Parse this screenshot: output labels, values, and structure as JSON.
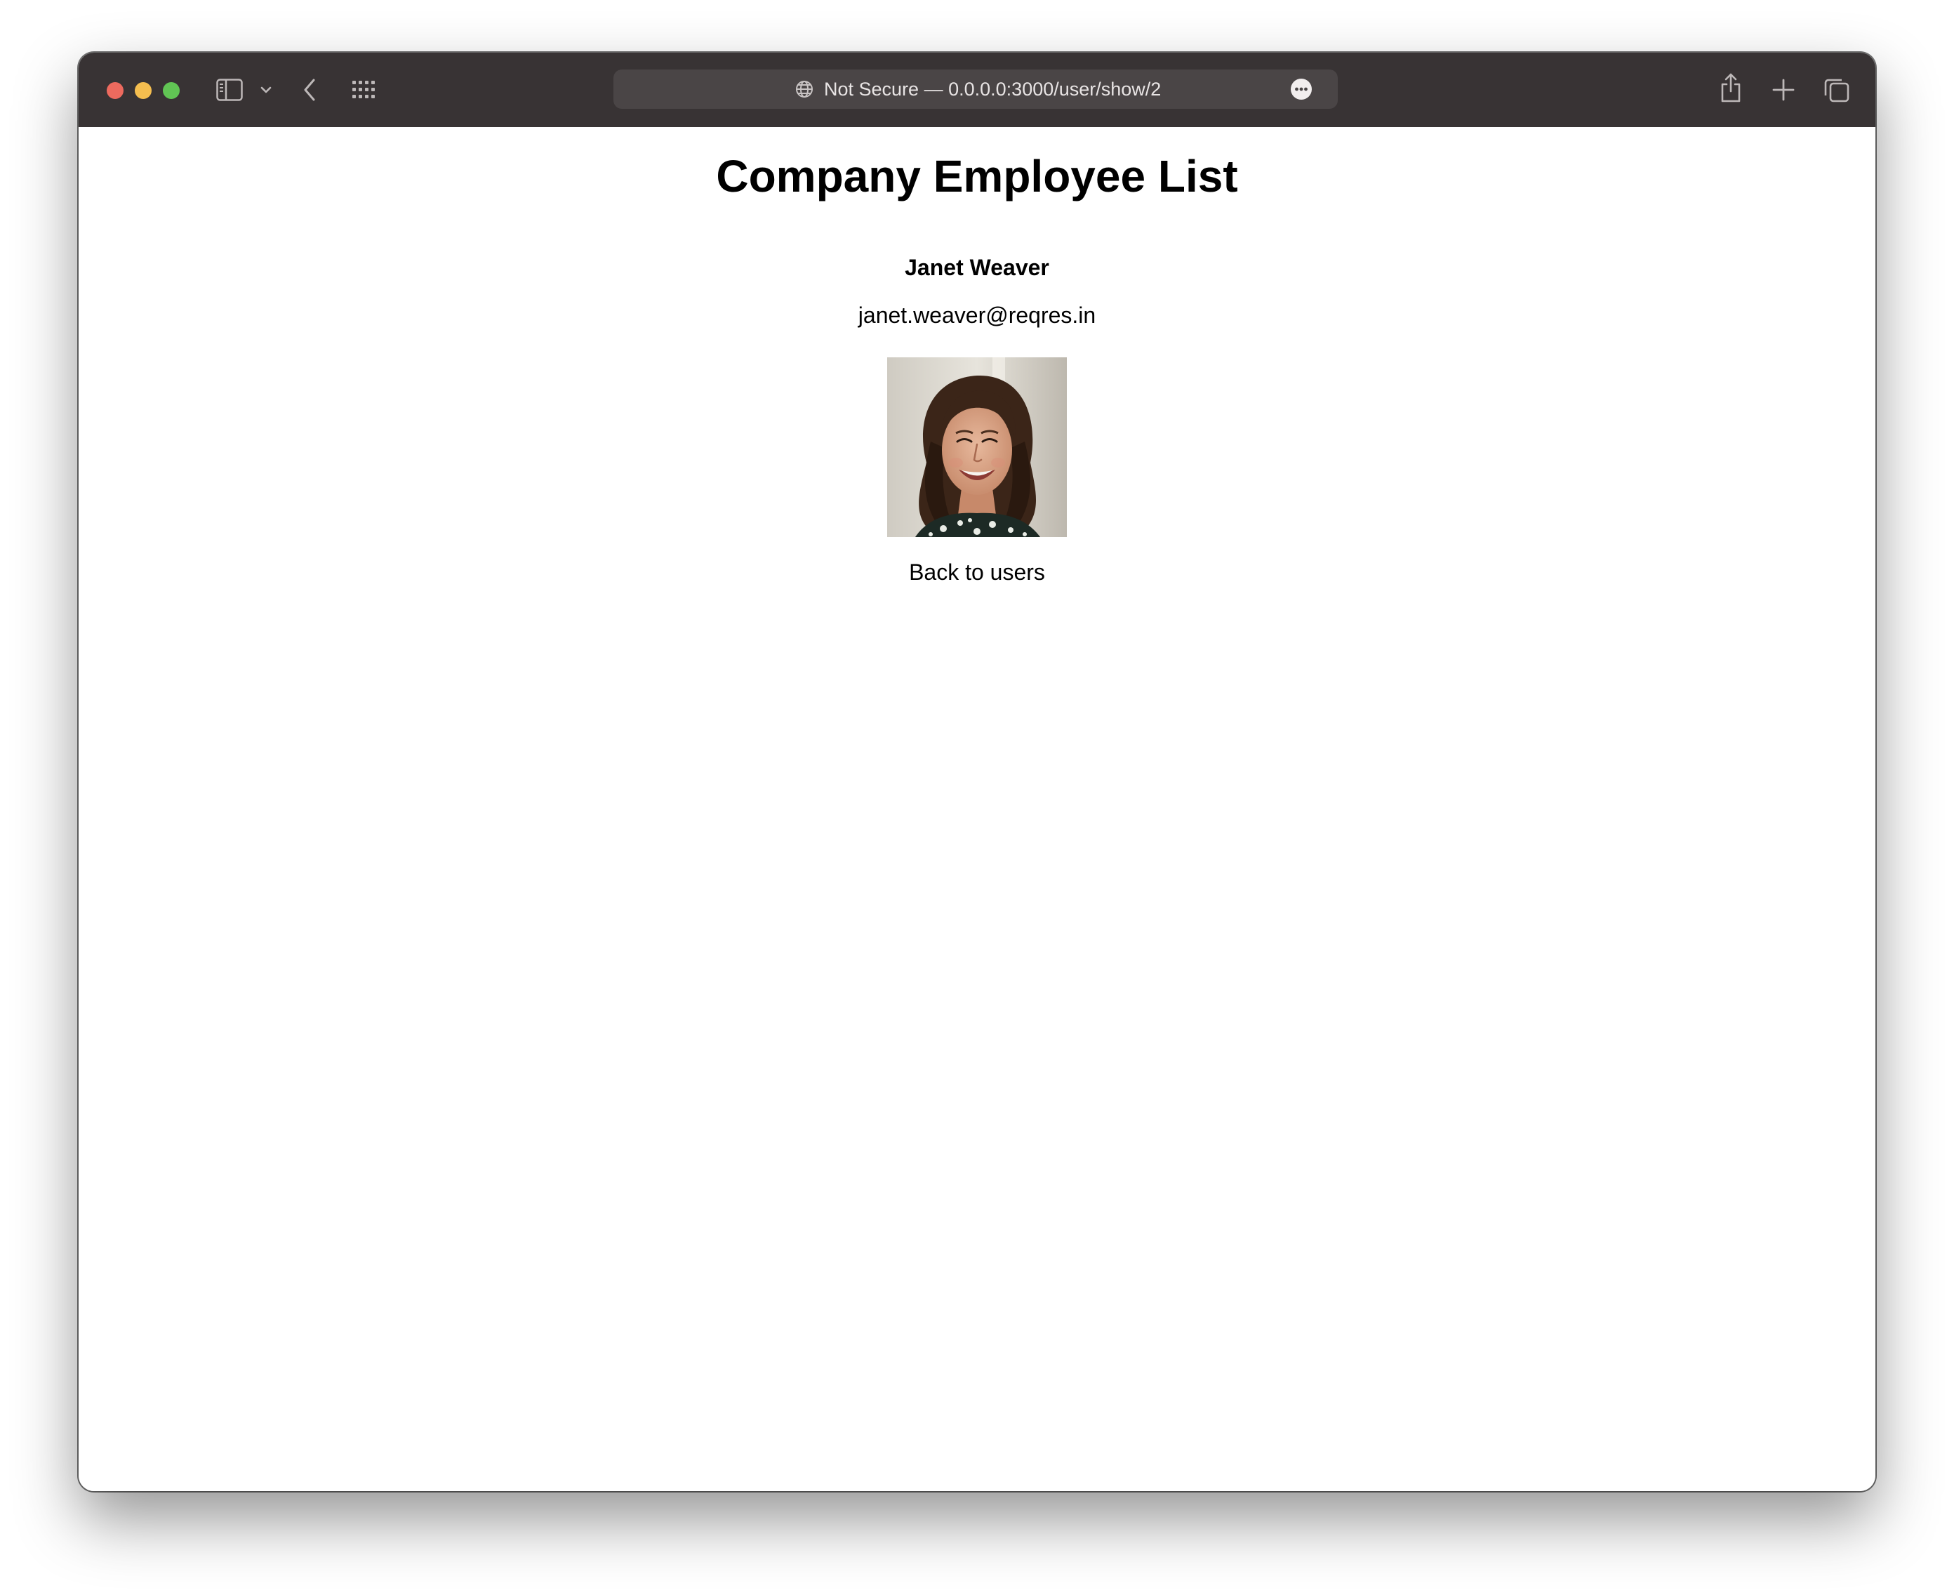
{
  "browser": {
    "address_bar": {
      "security_label": "Not Secure",
      "separator": "—",
      "url": "0.0.0.0:3000/user/show/2"
    },
    "icons": {
      "sidebar": "sidebar-icon",
      "sidebar_menu": "chevron-down-icon",
      "back": "chevron-left-icon",
      "tab_overview": "grid-icon",
      "site": "globe-icon",
      "more": "ellipsis-circle-icon",
      "share": "share-icon",
      "new_tab": "plus-icon",
      "tabs": "tabs-icon"
    },
    "colors": {
      "titlebar": "#383334",
      "urlbar": "#4a4546",
      "close": "#ed6a5e",
      "minimize": "#f5be4f",
      "zoom": "#61c554"
    }
  },
  "page": {
    "title": "Company Employee List",
    "user": {
      "name": "Janet Weaver",
      "email": "janet.weaver@reqres.in",
      "avatar_icon": "avatar-photo"
    },
    "back_link": "Back to users"
  }
}
